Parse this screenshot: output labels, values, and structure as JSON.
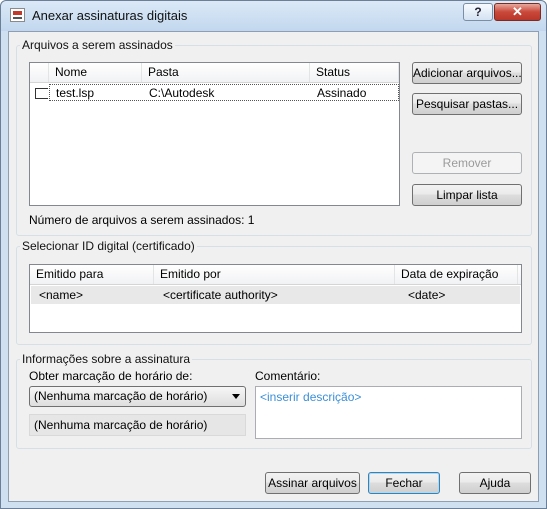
{
  "window": {
    "title": "Anexar assinaturas digitais",
    "help_label": "?",
    "close_label": "✕"
  },
  "files_group": {
    "title": "Arquivos a serem assinados",
    "columns": [
      "Nome",
      "Pasta",
      "Status"
    ],
    "rows": [
      {
        "name": "test.lsp",
        "folder": "C:\\Autodesk",
        "status": "Assinado"
      }
    ],
    "count_text": "Número de arquivos a serem assinados: 1",
    "buttons": {
      "add_files": "Adicionar arquivos...",
      "search_folders": "Pesquisar pastas...",
      "remove": "Remover",
      "clear_list": "Limpar lista"
    }
  },
  "certificate_group": {
    "title": "Selecionar ID digital (certificado)",
    "columns": [
      "Emitido para",
      "Emitido por",
      "Data de expiração"
    ],
    "rows": [
      {
        "issued_to": "<name>",
        "issued_by": "<certificate authority>",
        "expiration": "<date>"
      }
    ]
  },
  "signature_group": {
    "title": "Informações sobre a assinatura",
    "timestamp_label": "Obter marcação de horário de:",
    "timestamp_value": "(Nenhuma marcação de horário)",
    "timestamp_readonly": "(Nenhuma marcação de horário)",
    "comment_label": "Comentário:",
    "comment_placeholder": "<inserir descrição>"
  },
  "footer": {
    "sign_files": "Assinar arquivos",
    "close": "Fechar",
    "help": "Ajuda"
  }
}
